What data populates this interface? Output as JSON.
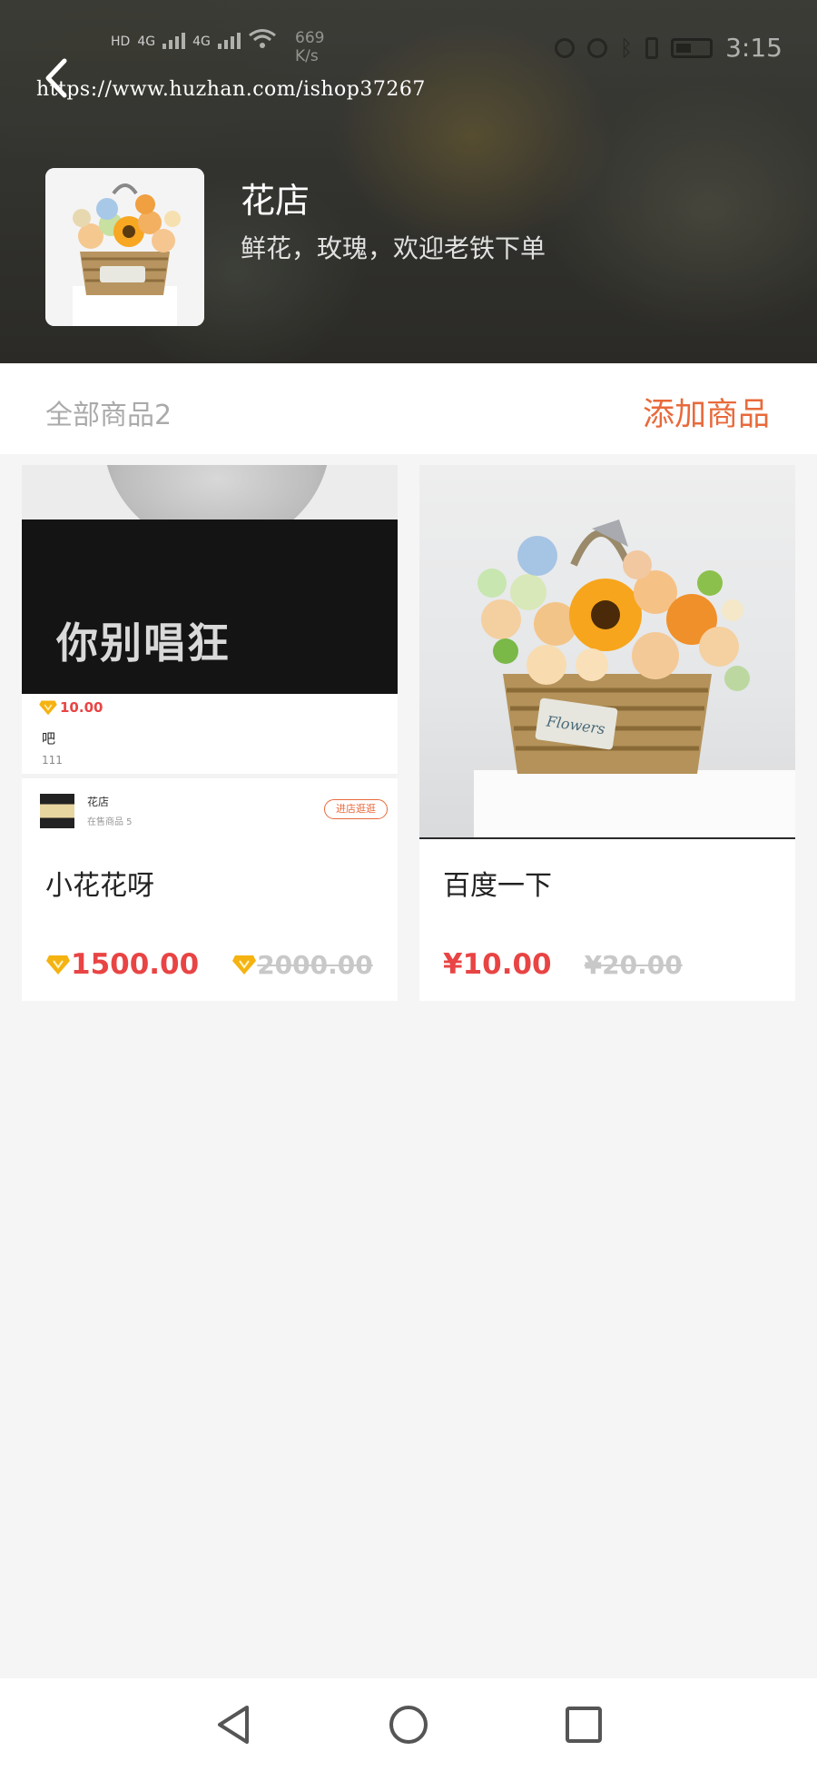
{
  "status_bar": {
    "network_left": "HD",
    "net_type": "4G",
    "speed_value": "669",
    "speed_unit": "K/s",
    "time": "3:15"
  },
  "url": "https://www.huzhan.com/ishop37267",
  "shop": {
    "name": "花店",
    "description": "鲜花，玫瑰，欢迎老铁下单"
  },
  "section": {
    "all_products_label": "全部商品2",
    "add_product_label": "添加商品"
  },
  "products": [
    {
      "title": "小花花呀",
      "price": "1500.00",
      "original_price": "2000.00",
      "price_icon": "gem-icon",
      "image": {
        "caption": "你别唱狂",
        "price": "10.00",
        "name": "吧",
        "meta": "111",
        "shop_name": "花店",
        "shop_count": "在售商品 5",
        "visit_label": "进店逛逛"
      }
    },
    {
      "title": "百度一下",
      "price": "¥10.00",
      "original_price": "¥20.00",
      "image": {
        "label": "Flowers"
      }
    }
  ],
  "colors": {
    "accent": "#e86a3b",
    "price": "#e94444",
    "gem": "#f5b312",
    "strike": "#c8c8c8"
  },
  "nav": {
    "back_icon": "triangle-back-icon",
    "home_icon": "circle-home-icon",
    "recent_icon": "square-recent-icon"
  }
}
